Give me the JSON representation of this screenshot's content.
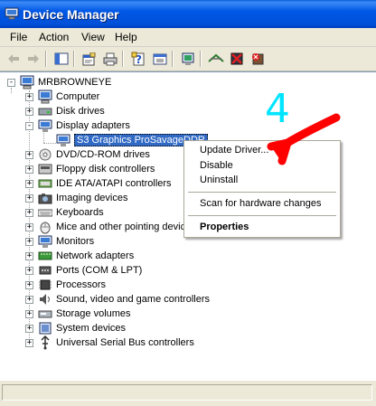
{
  "window": {
    "title": "Device Manager"
  },
  "menubar": {
    "file": "File",
    "action": "Action",
    "view": "View",
    "help": "Help"
  },
  "toolbar": {
    "icons": [
      "back-arrow-icon",
      "forward-arrow-icon",
      "show-hide-console-tree-icon",
      "properties-icon",
      "print-icon",
      "help-icon",
      "export-list-icon",
      "scan-hardware-icon",
      "update-driver-icon",
      "disable-device-icon",
      "uninstall-device-icon"
    ]
  },
  "tree": {
    "root": "MRBROWNEYE",
    "categories": [
      {
        "label": "Computer",
        "icon": "computer-icon"
      },
      {
        "label": "Disk drives",
        "icon": "disk-drive-icon"
      },
      {
        "label": "Display adapters",
        "icon": "display-adapter-icon",
        "expanded": true,
        "children": [
          {
            "label": "S3 Graphics ProSavageDDR",
            "selected": true
          }
        ]
      },
      {
        "label": "DVD/CD-ROM drives",
        "icon": "cdrom-icon"
      },
      {
        "label": "Floppy disk controllers",
        "icon": "floppy-controller-icon"
      },
      {
        "label": "IDE ATA/ATAPI controllers",
        "icon": "ide-controller-icon"
      },
      {
        "label": "Imaging devices",
        "icon": "camera-icon"
      },
      {
        "label": "Keyboards",
        "icon": "keyboard-icon"
      },
      {
        "label": "Mice and other pointing devic",
        "icon": "mouse-icon"
      },
      {
        "label": "Monitors",
        "icon": "monitor-icon"
      },
      {
        "label": "Network adapters",
        "icon": "network-adapter-icon"
      },
      {
        "label": "Ports (COM & LPT)",
        "icon": "port-icon"
      },
      {
        "label": "Processors",
        "icon": "processor-icon"
      },
      {
        "label": "Sound, video and game controllers",
        "icon": "sound-icon"
      },
      {
        "label": "Storage volumes",
        "icon": "storage-volume-icon"
      },
      {
        "label": "System devices",
        "icon": "system-device-icon"
      },
      {
        "label": "Universal Serial Bus controllers",
        "icon": "usb-icon"
      }
    ]
  },
  "context_menu": {
    "update_driver": "Update Driver...",
    "disable": "Disable",
    "uninstall": "Uninstall",
    "scan": "Scan for hardware changes",
    "properties": "Properties"
  },
  "annotation": {
    "step_number": "4",
    "number_color": "#00e5ff",
    "arrow_color": "#ff0000"
  }
}
